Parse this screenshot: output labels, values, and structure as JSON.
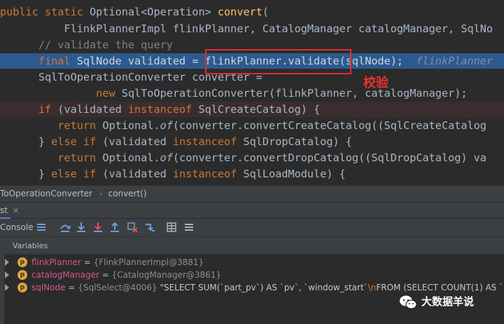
{
  "editor": {
    "lines": [
      {
        "segments": [
          {
            "t": "public static ",
            "c": "kw"
          },
          {
            "t": "Optional<Operation> ",
            "c": "pl"
          },
          {
            "t": "convert",
            "c": "fn"
          },
          {
            "t": "(",
            "c": "pl"
          }
        ]
      },
      {
        "segments": [
          {
            "t": "          FlinkPlannerImpl flinkPlanner, CatalogManager catalogManager, SqlNo",
            "c": "pl"
          }
        ]
      },
      {
        "segments": [
          {
            "t": "      // validate the query",
            "c": "cm"
          }
        ]
      },
      {
        "segments": [
          {
            "t": "      final ",
            "c": "kw"
          },
          {
            "t": "SqlNode validated = ",
            "c": "pl txt"
          },
          {
            "t": "flinkPlanner.validate",
            "c": "pl txt"
          },
          {
            "t": "(sqlNode);  ",
            "c": "pl txt"
          },
          {
            "t": "flinkPlanner",
            "c": "hint"
          }
        ]
      },
      {
        "segments": [
          {
            "t": "      SqlToOperationConverter converter =",
            "c": "pl"
          }
        ]
      },
      {
        "segments": [
          {
            "t": "               new ",
            "c": "kw"
          },
          {
            "t": "SqlToOperationConverter(flinkPlanner, catalogManager);",
            "c": "pl"
          }
        ]
      },
      {
        "segments": [
          {
            "t": "      if ",
            "c": "kw"
          },
          {
            "t": "(validated ",
            "c": "pl"
          },
          {
            "t": "instanceof ",
            "c": "kw"
          },
          {
            "t": "SqlCreateCatalog) {",
            "c": "pl"
          }
        ]
      },
      {
        "segments": [
          {
            "t": "         return ",
            "c": "kw"
          },
          {
            "t": "Optional.",
            "c": "pl"
          },
          {
            "t": "of",
            "c": "pl it"
          },
          {
            "t": "(converter.convertCreateCatalog((SqlCreateCatalog",
            "c": "pl"
          }
        ]
      },
      {
        "segments": [
          {
            "t": "      } ",
            "c": "pl"
          },
          {
            "t": "else if ",
            "c": "kw"
          },
          {
            "t": "(validated ",
            "c": "pl"
          },
          {
            "t": "instanceof ",
            "c": "kw"
          },
          {
            "t": "SqlDropCatalog) {",
            "c": "pl"
          }
        ]
      },
      {
        "segments": [
          {
            "t": "         return ",
            "c": "kw"
          },
          {
            "t": "Optional.",
            "c": "pl"
          },
          {
            "t": "of",
            "c": "pl it"
          },
          {
            "t": "(converter.convertDropCatalog((SqlDropCatalog) va",
            "c": "pl"
          }
        ]
      },
      {
        "segments": [
          {
            "t": "      } ",
            "c": "pl"
          },
          {
            "t": "else if ",
            "c": "kw"
          },
          {
            "t": "(validated ",
            "c": "pl"
          },
          {
            "t": "instanceof ",
            "c": "kw"
          },
          {
            "t": "SqlLoadModule) {",
            "c": "pl"
          }
        ]
      }
    ],
    "annotation": "校验"
  },
  "breadcrumb": {
    "items": [
      "ToOperationConverter",
      "convert()"
    ],
    "separator": "›"
  },
  "debug": {
    "tab_label": "st",
    "console_label": "Console"
  },
  "variables": {
    "header": "Variables",
    "items": [
      {
        "name": "flinkPlanner",
        "eq": " = ",
        "ref": "{FlinkPlannerImpl@3881}",
        "value": ""
      },
      {
        "name": "catalogManager",
        "eq": " = ",
        "ref": "{CatalogManager@3861}",
        "value": ""
      },
      {
        "name": "sqlNode",
        "eq": " = ",
        "ref": "{SqlSelect@4006}",
        "value": " \"SELECT SUM(`part_pv`) AS `pv`, `window_start`",
        "esc": "\\n",
        "tail": "FROM (SELECT COUNT(1) AS `pa"
      }
    ],
    "badge": "p"
  },
  "watermark": {
    "text": "大数据羊说"
  },
  "colors": {
    "editor_bg": "#2b2b2b",
    "highlight_line": "#2d5a8e",
    "keyword": "#cc7832",
    "method": "#ffc66d",
    "comment": "#808080",
    "annotation_red": "#e02d2d",
    "variable_name": "#d0598e",
    "panel_bg": "#3c3f41"
  }
}
